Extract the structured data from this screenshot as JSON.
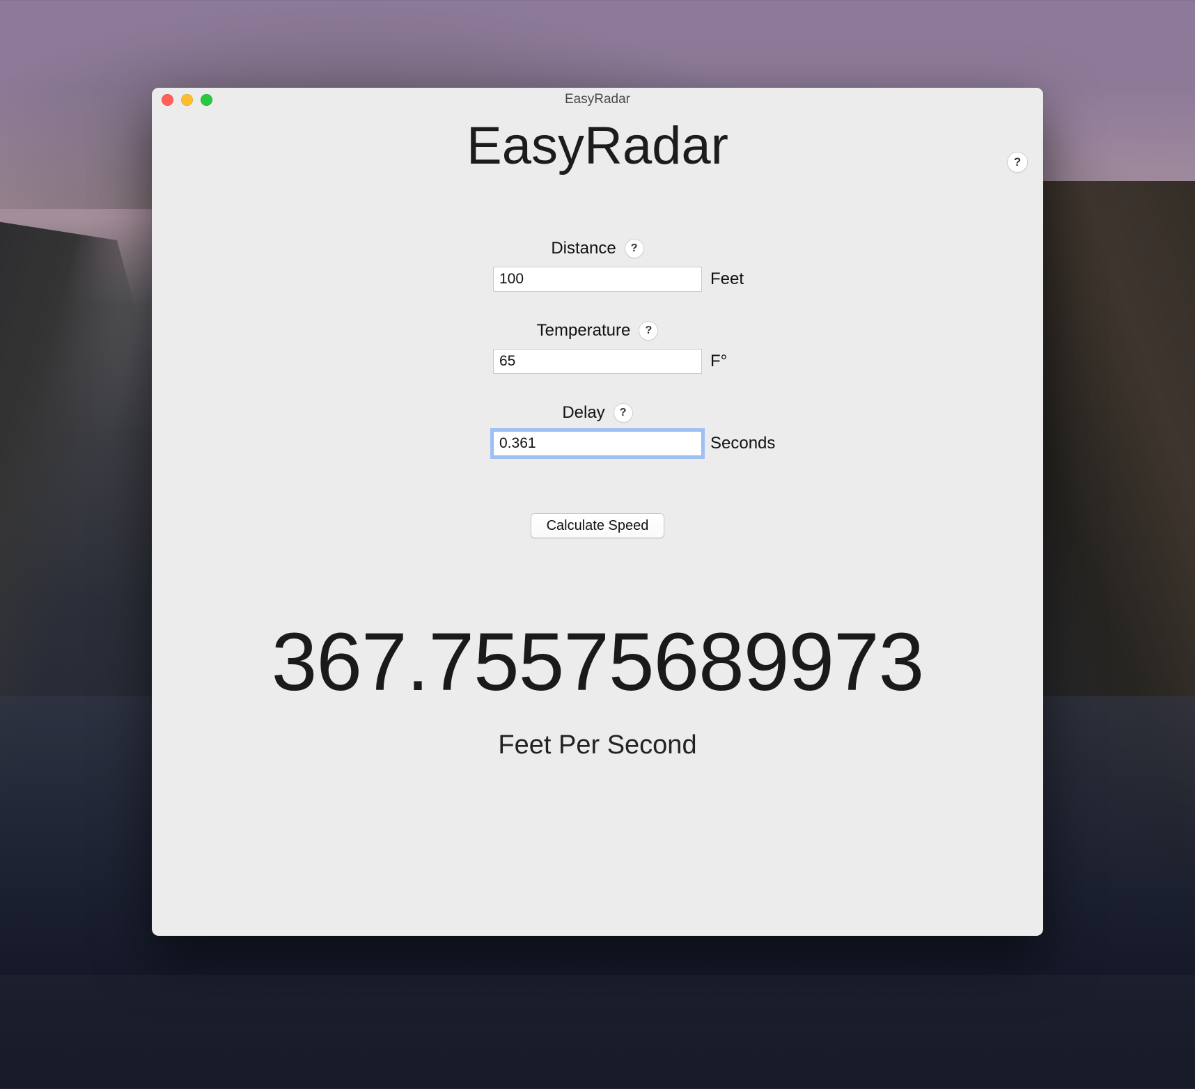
{
  "window": {
    "title": "EasyRadar"
  },
  "app": {
    "heading": "EasyRadar"
  },
  "help": {
    "glyph": "?"
  },
  "fields": {
    "distance": {
      "label": "Distance",
      "value": "100",
      "unit": "Feet"
    },
    "temperature": {
      "label": "Temperature",
      "value": "65",
      "unit": "F°"
    },
    "delay": {
      "label": "Delay",
      "value": "0.361",
      "unit": "Seconds",
      "focused": true
    }
  },
  "actions": {
    "calculate_label": "Calculate Speed"
  },
  "result": {
    "value": "367.75575689973",
    "unit": "Feet Per Second"
  }
}
